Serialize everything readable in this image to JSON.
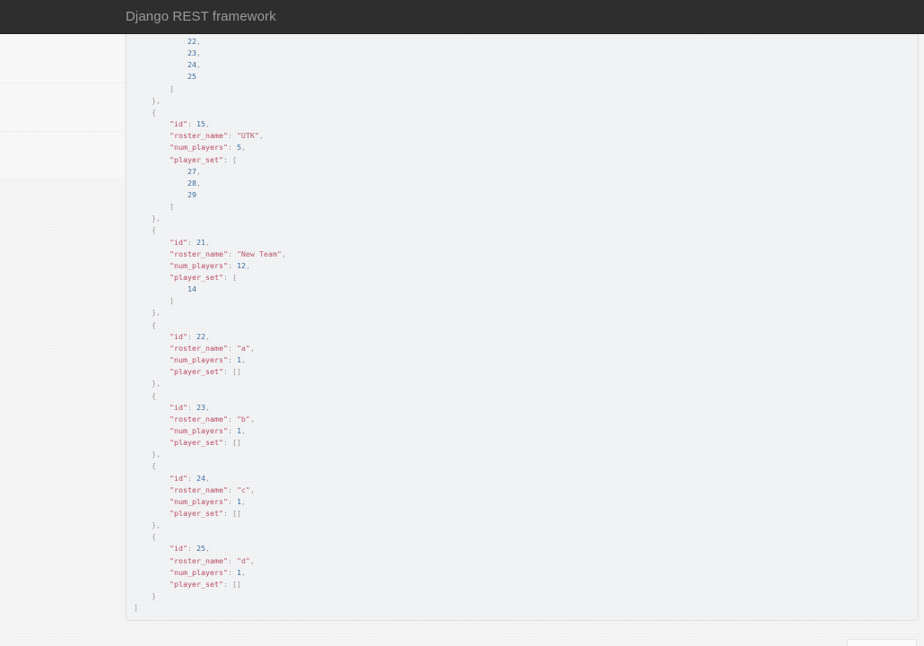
{
  "navbar": {
    "brand": "Django REST framework"
  },
  "response": {
    "lines": [
      {
        "indent": 3,
        "tokens": [
          {
            "t": "n",
            "v": "22"
          },
          {
            "t": "p",
            "v": ","
          }
        ]
      },
      {
        "indent": 3,
        "tokens": [
          {
            "t": "n",
            "v": "23"
          },
          {
            "t": "p",
            "v": ","
          }
        ]
      },
      {
        "indent": 3,
        "tokens": [
          {
            "t": "n",
            "v": "24"
          },
          {
            "t": "p",
            "v": ","
          }
        ]
      },
      {
        "indent": 3,
        "tokens": [
          {
            "t": "n",
            "v": "25"
          }
        ]
      },
      {
        "indent": 2,
        "tokens": [
          {
            "t": "p",
            "v": "]"
          }
        ]
      },
      {
        "indent": 1,
        "tokens": [
          {
            "t": "p",
            "v": "},"
          }
        ]
      },
      {
        "indent": 1,
        "tokens": [
          {
            "t": "p",
            "v": "{"
          }
        ]
      },
      {
        "indent": 2,
        "tokens": [
          {
            "t": "k",
            "v": "\"id\""
          },
          {
            "t": "p",
            "v": ": "
          },
          {
            "t": "n",
            "v": "15"
          },
          {
            "t": "p",
            "v": ","
          }
        ]
      },
      {
        "indent": 2,
        "tokens": [
          {
            "t": "k",
            "v": "\"roster_name\""
          },
          {
            "t": "p",
            "v": ": "
          },
          {
            "t": "s",
            "v": "\"UTK\""
          },
          {
            "t": "p",
            "v": ","
          }
        ]
      },
      {
        "indent": 2,
        "tokens": [
          {
            "t": "k",
            "v": "\"num_players\""
          },
          {
            "t": "p",
            "v": ": "
          },
          {
            "t": "n",
            "v": "5"
          },
          {
            "t": "p",
            "v": ","
          }
        ]
      },
      {
        "indent": 2,
        "tokens": [
          {
            "t": "k",
            "v": "\"player_set\""
          },
          {
            "t": "p",
            "v": ": ["
          }
        ]
      },
      {
        "indent": 3,
        "tokens": [
          {
            "t": "n",
            "v": "27"
          },
          {
            "t": "p",
            "v": ","
          }
        ]
      },
      {
        "indent": 3,
        "tokens": [
          {
            "t": "n",
            "v": "28"
          },
          {
            "t": "p",
            "v": ","
          }
        ]
      },
      {
        "indent": 3,
        "tokens": [
          {
            "t": "n",
            "v": "29"
          }
        ]
      },
      {
        "indent": 2,
        "tokens": [
          {
            "t": "p",
            "v": "]"
          }
        ]
      },
      {
        "indent": 1,
        "tokens": [
          {
            "t": "p",
            "v": "},"
          }
        ]
      },
      {
        "indent": 1,
        "tokens": [
          {
            "t": "p",
            "v": "{"
          }
        ]
      },
      {
        "indent": 2,
        "tokens": [
          {
            "t": "k",
            "v": "\"id\""
          },
          {
            "t": "p",
            "v": ": "
          },
          {
            "t": "n",
            "v": "21"
          },
          {
            "t": "p",
            "v": ","
          }
        ]
      },
      {
        "indent": 2,
        "tokens": [
          {
            "t": "k",
            "v": "\"roster_name\""
          },
          {
            "t": "p",
            "v": ": "
          },
          {
            "t": "s",
            "v": "\"New Team\""
          },
          {
            "t": "p",
            "v": ","
          }
        ]
      },
      {
        "indent": 2,
        "tokens": [
          {
            "t": "k",
            "v": "\"num_players\""
          },
          {
            "t": "p",
            "v": ": "
          },
          {
            "t": "n",
            "v": "12"
          },
          {
            "t": "p",
            "v": ","
          }
        ]
      },
      {
        "indent": 2,
        "tokens": [
          {
            "t": "k",
            "v": "\"player_set\""
          },
          {
            "t": "p",
            "v": ": ["
          }
        ]
      },
      {
        "indent": 3,
        "tokens": [
          {
            "t": "n",
            "v": "14"
          }
        ]
      },
      {
        "indent": 2,
        "tokens": [
          {
            "t": "p",
            "v": "]"
          }
        ]
      },
      {
        "indent": 1,
        "tokens": [
          {
            "t": "p",
            "v": "},"
          }
        ]
      },
      {
        "indent": 1,
        "tokens": [
          {
            "t": "p",
            "v": "{"
          }
        ]
      },
      {
        "indent": 2,
        "tokens": [
          {
            "t": "k",
            "v": "\"id\""
          },
          {
            "t": "p",
            "v": ": "
          },
          {
            "t": "n",
            "v": "22"
          },
          {
            "t": "p",
            "v": ","
          }
        ]
      },
      {
        "indent": 2,
        "tokens": [
          {
            "t": "k",
            "v": "\"roster_name\""
          },
          {
            "t": "p",
            "v": ": "
          },
          {
            "t": "s",
            "v": "\"a\""
          },
          {
            "t": "p",
            "v": ","
          }
        ]
      },
      {
        "indent": 2,
        "tokens": [
          {
            "t": "k",
            "v": "\"num_players\""
          },
          {
            "t": "p",
            "v": ": "
          },
          {
            "t": "n",
            "v": "1"
          },
          {
            "t": "p",
            "v": ","
          }
        ]
      },
      {
        "indent": 2,
        "tokens": [
          {
            "t": "k",
            "v": "\"player_set\""
          },
          {
            "t": "p",
            "v": ": []"
          }
        ]
      },
      {
        "indent": 1,
        "tokens": [
          {
            "t": "p",
            "v": "},"
          }
        ]
      },
      {
        "indent": 1,
        "tokens": [
          {
            "t": "p",
            "v": "{"
          }
        ]
      },
      {
        "indent": 2,
        "tokens": [
          {
            "t": "k",
            "v": "\"id\""
          },
          {
            "t": "p",
            "v": ": "
          },
          {
            "t": "n",
            "v": "23"
          },
          {
            "t": "p",
            "v": ","
          }
        ]
      },
      {
        "indent": 2,
        "tokens": [
          {
            "t": "k",
            "v": "\"roster_name\""
          },
          {
            "t": "p",
            "v": ": "
          },
          {
            "t": "s",
            "v": "\"b\""
          },
          {
            "t": "p",
            "v": ","
          }
        ]
      },
      {
        "indent": 2,
        "tokens": [
          {
            "t": "k",
            "v": "\"num_players\""
          },
          {
            "t": "p",
            "v": ": "
          },
          {
            "t": "n",
            "v": "1"
          },
          {
            "t": "p",
            "v": ","
          }
        ]
      },
      {
        "indent": 2,
        "tokens": [
          {
            "t": "k",
            "v": "\"player_set\""
          },
          {
            "t": "p",
            "v": ": []"
          }
        ]
      },
      {
        "indent": 1,
        "tokens": [
          {
            "t": "p",
            "v": "},"
          }
        ]
      },
      {
        "indent": 1,
        "tokens": [
          {
            "t": "p",
            "v": "{"
          }
        ]
      },
      {
        "indent": 2,
        "tokens": [
          {
            "t": "k",
            "v": "\"id\""
          },
          {
            "t": "p",
            "v": ": "
          },
          {
            "t": "n",
            "v": "24"
          },
          {
            "t": "p",
            "v": ","
          }
        ]
      },
      {
        "indent": 2,
        "tokens": [
          {
            "t": "k",
            "v": "\"roster_name\""
          },
          {
            "t": "p",
            "v": ": "
          },
          {
            "t": "s",
            "v": "\"c\""
          },
          {
            "t": "p",
            "v": ","
          }
        ]
      },
      {
        "indent": 2,
        "tokens": [
          {
            "t": "k",
            "v": "\"num_players\""
          },
          {
            "t": "p",
            "v": ": "
          },
          {
            "t": "n",
            "v": "1"
          },
          {
            "t": "p",
            "v": ","
          }
        ]
      },
      {
        "indent": 2,
        "tokens": [
          {
            "t": "k",
            "v": "\"player_set\""
          },
          {
            "t": "p",
            "v": ": []"
          }
        ]
      },
      {
        "indent": 1,
        "tokens": [
          {
            "t": "p",
            "v": "},"
          }
        ]
      },
      {
        "indent": 1,
        "tokens": [
          {
            "t": "p",
            "v": "{"
          }
        ]
      },
      {
        "indent": 2,
        "tokens": [
          {
            "t": "k",
            "v": "\"id\""
          },
          {
            "t": "p",
            "v": ": "
          },
          {
            "t": "n",
            "v": "25"
          },
          {
            "t": "p",
            "v": ","
          }
        ]
      },
      {
        "indent": 2,
        "tokens": [
          {
            "t": "k",
            "v": "\"roster_name\""
          },
          {
            "t": "p",
            "v": ": "
          },
          {
            "t": "s",
            "v": "\"d\""
          },
          {
            "t": "p",
            "v": ","
          }
        ]
      },
      {
        "indent": 2,
        "tokens": [
          {
            "t": "k",
            "v": "\"num_players\""
          },
          {
            "t": "p",
            "v": ": "
          },
          {
            "t": "n",
            "v": "1"
          },
          {
            "t": "p",
            "v": ","
          }
        ]
      },
      {
        "indent": 2,
        "tokens": [
          {
            "t": "k",
            "v": "\"player_set\""
          },
          {
            "t": "p",
            "v": ": []"
          }
        ]
      },
      {
        "indent": 1,
        "tokens": [
          {
            "t": "p",
            "v": "}"
          }
        ]
      },
      {
        "indent": 0,
        "tokens": [
          {
            "t": "p",
            "v": "]"
          }
        ]
      }
    ]
  }
}
